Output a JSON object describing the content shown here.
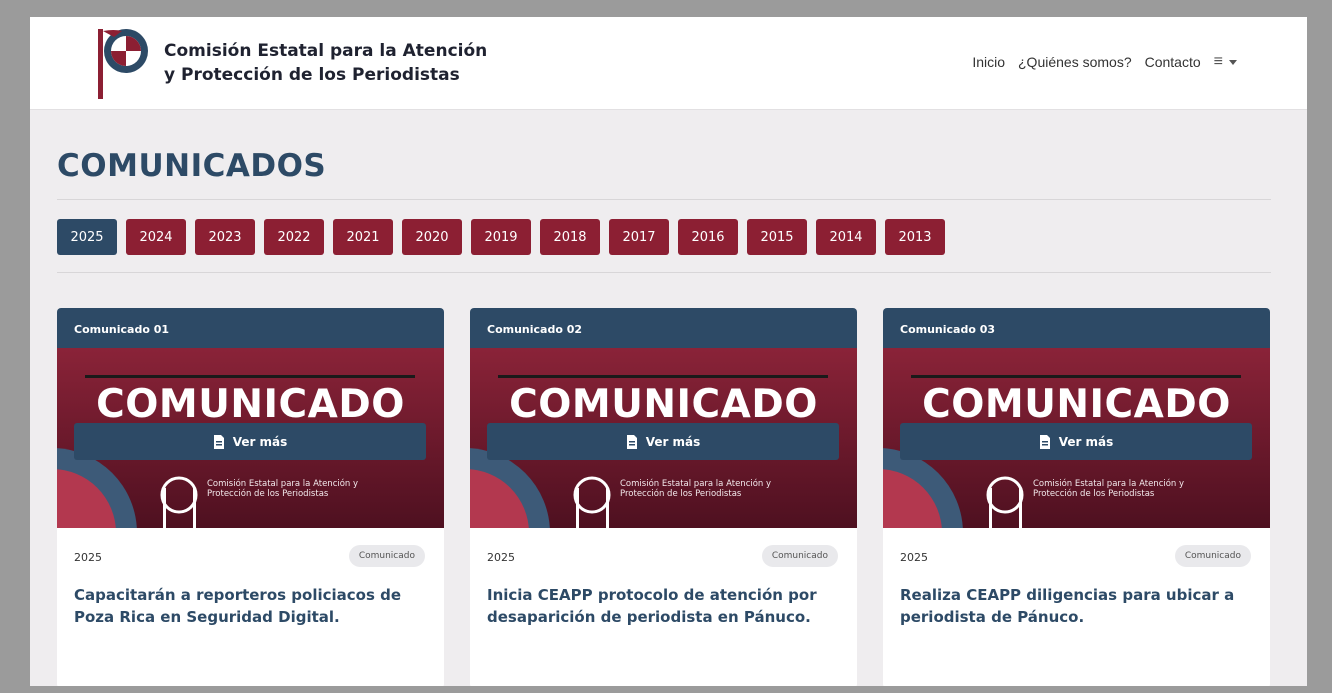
{
  "header": {
    "org_line1": "Comisión Estatal para la Atención",
    "org_line2": "y Protección de los Periodistas",
    "nav": [
      "Inicio",
      "¿Quiénes somos?",
      "Contacto"
    ],
    "menu_icon": "hamburger-icon"
  },
  "page": {
    "title": "COMUNICADOS"
  },
  "years": [
    "2025",
    "2024",
    "2023",
    "2022",
    "2021",
    "2020",
    "2019",
    "2018",
    "2017",
    "2016",
    "2015",
    "2014",
    "2013"
  ],
  "active_year": "2025",
  "cards": [
    {
      "header": "Comunicado 01",
      "banner_word": "COMUNICADO",
      "banner_org": "Comisión Estatal para la Atención y Protección de los Periodistas",
      "year": "2025",
      "badge": "Comunicado",
      "title": "Capacitarán a reporteros policiacos de Poza Rica en Seguridad Digital.",
      "button": "Ver más"
    },
    {
      "header": "Comunicado 02",
      "banner_word": "COMUNICADO",
      "banner_org": "Comisión Estatal para la Atención y Protección de los Periodistas",
      "year": "2025",
      "badge": "Comunicado",
      "title": "Inicia CEAPP protocolo de atención por desaparición de periodista en Pánuco.",
      "button": "Ver más"
    },
    {
      "header": "Comunicado 03",
      "banner_word": "COMUNICADO",
      "banner_org": "Comisión Estatal para la Atención y Protección de los Periodistas",
      "year": "2025",
      "badge": "Comunicado",
      "title": "Realiza CEAPP diligencias para ubicar a periodista de Pánuco.",
      "button": "Ver más"
    }
  ],
  "colors": {
    "primary_blue": "#2d4a66",
    "primary_red": "#8c1f33",
    "banner_dark": "#5e1528",
    "page_bg": "#efedef"
  }
}
